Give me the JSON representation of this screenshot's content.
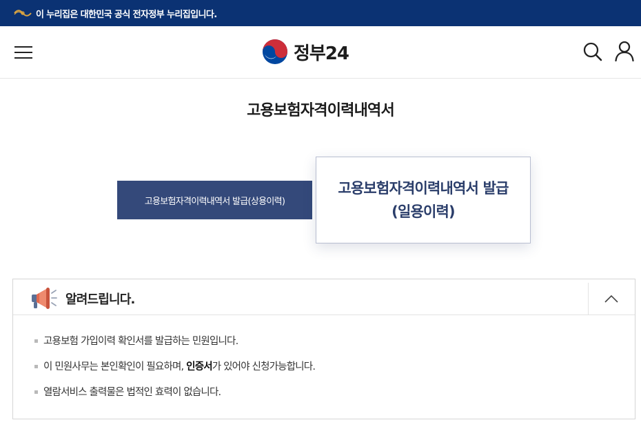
{
  "gov_banner": {
    "text": "이 누리집은 대한민국 공식 전자정부 누리집입니다."
  },
  "header": {
    "logo_text": "정부24",
    "menu_icon": "hamburger-menu-icon",
    "search_icon": "search-icon",
    "user_icon": "user-icon"
  },
  "page": {
    "title": "고용보험자격이력내역서"
  },
  "buttons": {
    "regular": "고용보험자격이력내역서 발급(상용이력)",
    "daily": "고용보험자격이력내역서 발급(일용이력)"
  },
  "notice": {
    "title": "알려드립니다.",
    "icon": "megaphone-icon",
    "toggle_icon": "chevron-up-icon",
    "items": [
      "고용보험 가입이력 확인서를 발급하는 민원입니다.",
      {
        "before": "이 민원사무는 본인확인이 필요하며, ",
        "bold": "인증서",
        "after": "가 있어야 신청가능합니다."
      },
      "열람서비스 출력물은 법적인 효력이 없습니다."
    ]
  },
  "colors": {
    "gov_bar": "#0b3273",
    "primary_button": "#34497a",
    "secondary_button_text": "#2a3d6a",
    "logo_red": "#cd2e3a",
    "logo_blue": "#0047a0"
  }
}
